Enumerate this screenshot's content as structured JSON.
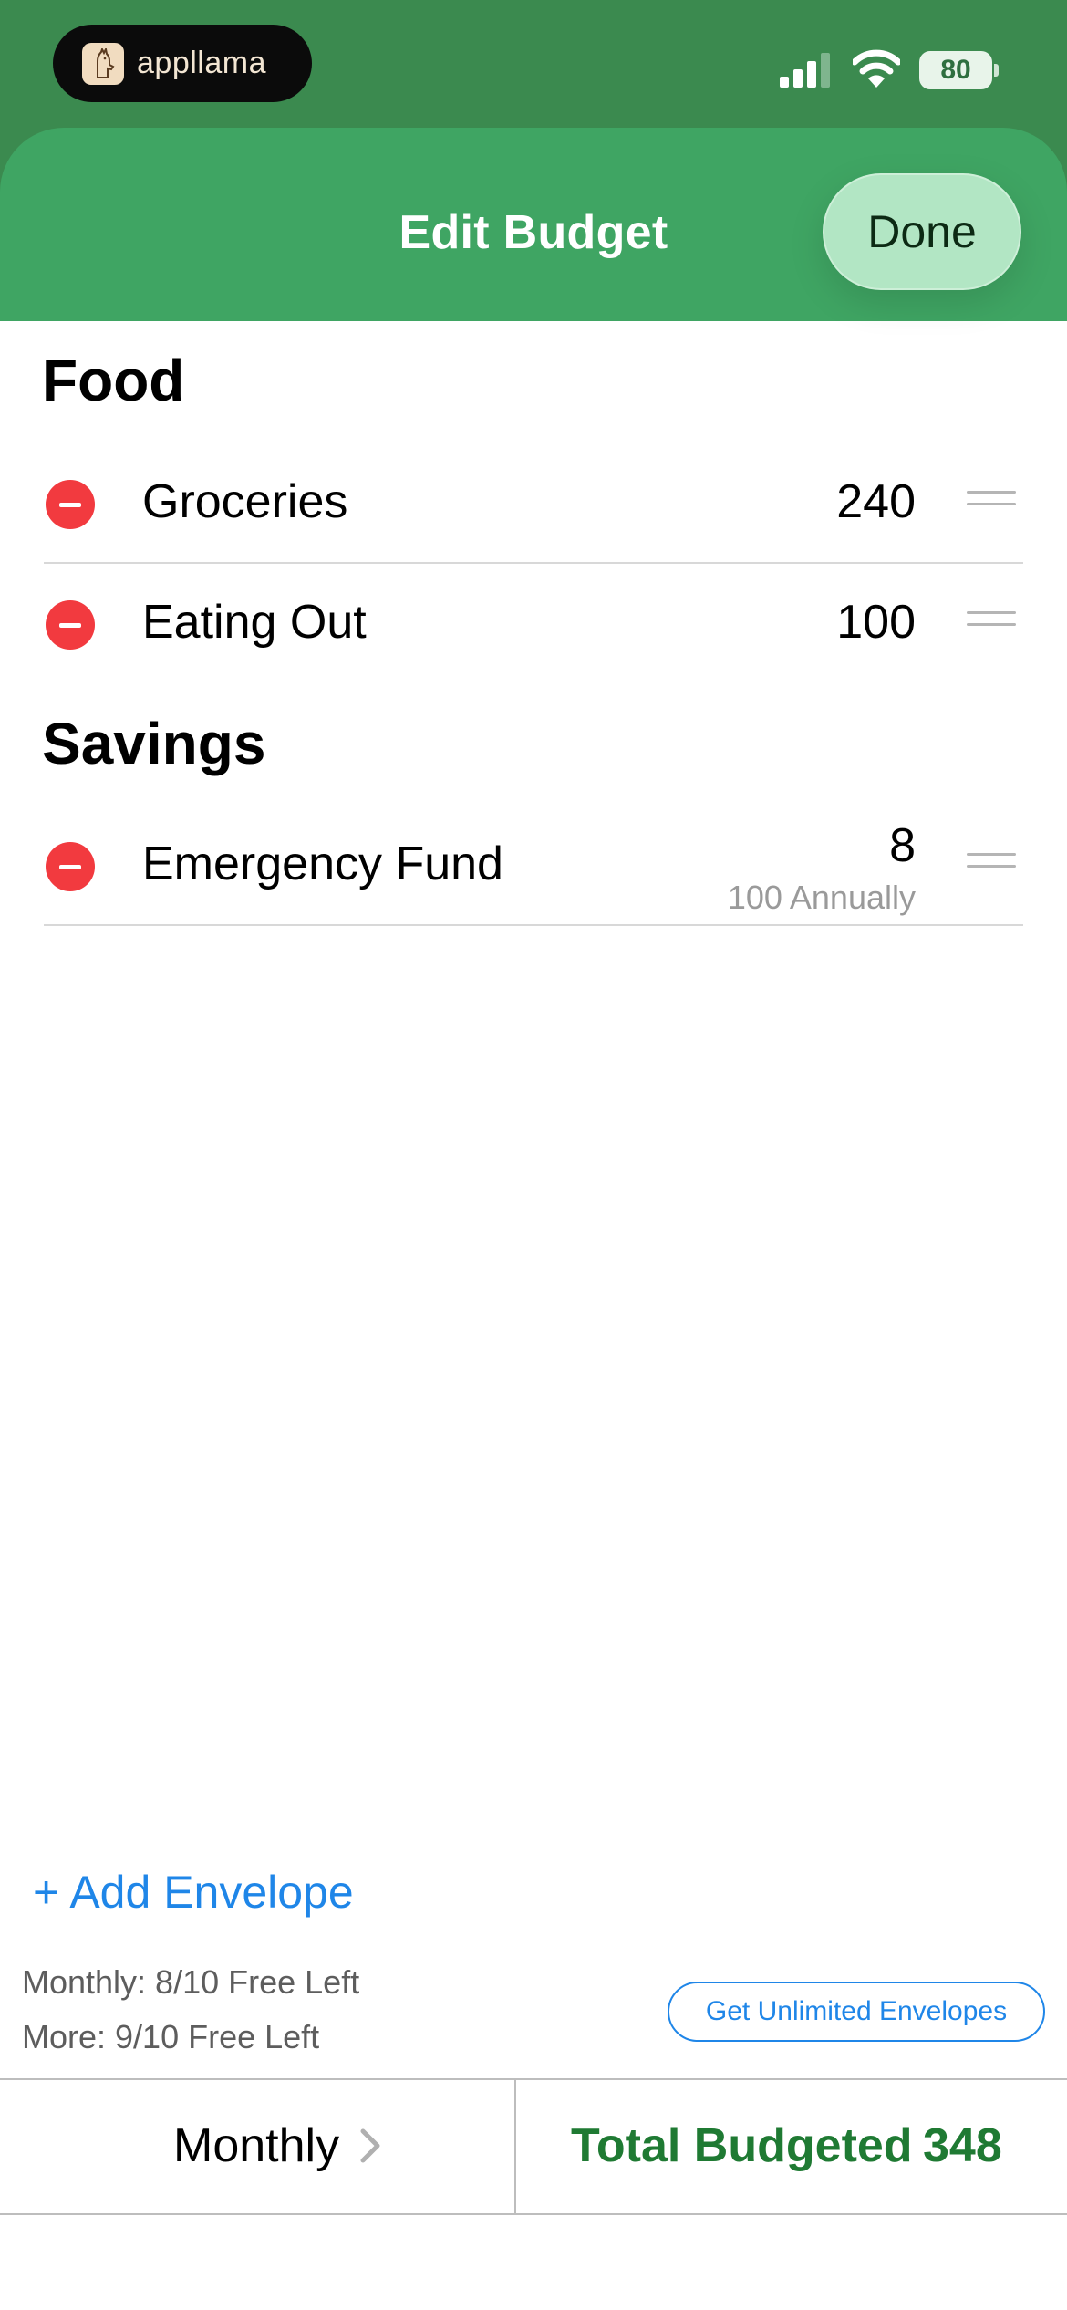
{
  "status_bar": {
    "app_name": "appllama",
    "battery": "80",
    "icons": [
      "cellular-signal-icon",
      "wifi-icon",
      "battery-icon"
    ]
  },
  "header": {
    "title": "Edit Budget",
    "done_label": "Done"
  },
  "sections": [
    {
      "title": "Food",
      "items": [
        {
          "name": "Groceries",
          "amount": "240"
        },
        {
          "name": "Eating Out",
          "amount": "100"
        }
      ]
    },
    {
      "title": "Savings",
      "items": [
        {
          "name": "Emergency Fund",
          "amount": "8",
          "sub": "100 Annually"
        }
      ]
    }
  ],
  "footer": {
    "add_envelope": "+ Add Envelope",
    "monthly_free": "Monthly: 8/10 Free Left",
    "more_free": "More: 9/10 Free Left",
    "unlimited_button": "Get Unlimited Envelopes",
    "period_label": "Monthly",
    "total_label": "Total Budgeted",
    "total_value": "348"
  },
  "colors": {
    "status_bar": "#3b8a4f",
    "header": "#3fa563",
    "done_button": "#b2e6c4",
    "delete": "#f23a3f",
    "link_blue": "#1f86e8",
    "total_green": "#1f7a33"
  }
}
